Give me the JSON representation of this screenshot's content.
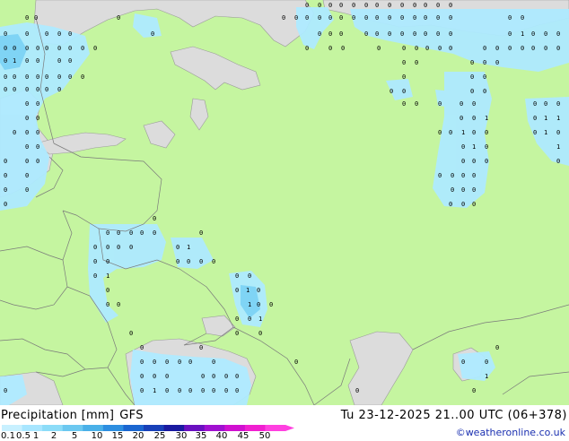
{
  "title": "Precipitation [mm]",
  "model": "GFS",
  "valid_time": "Tu 23-12-2025 21..00 UTC (06+378)",
  "credit": "©weatheronline.co.uk",
  "scale": {
    "labels": [
      "0.1",
      "0.5",
      "1",
      "2",
      "5",
      "10",
      "15",
      "20",
      "25",
      "30",
      "35",
      "40",
      "45",
      "50"
    ],
    "colors": [
      "#c8f0ff",
      "#a8e6ff",
      "#8cdcf8",
      "#6cc8f0",
      "#4ab0e8",
      "#2d8ee0",
      "#1b66d0",
      "#1840b8",
      "#1a1aa0",
      "#6a10c0",
      "#a010d0",
      "#d010d0",
      "#f020d0",
      "#ff40e0"
    ]
  },
  "colors": {
    "land": "#c5f5a0",
    "sea": "#dcdcdc",
    "precip_light": "#aeeaff",
    "precip_moderate": "#8cdcff",
    "border": "#7a7a7a"
  },
  "map": {
    "region": "Eastern Europe and Western Russia"
  }
}
